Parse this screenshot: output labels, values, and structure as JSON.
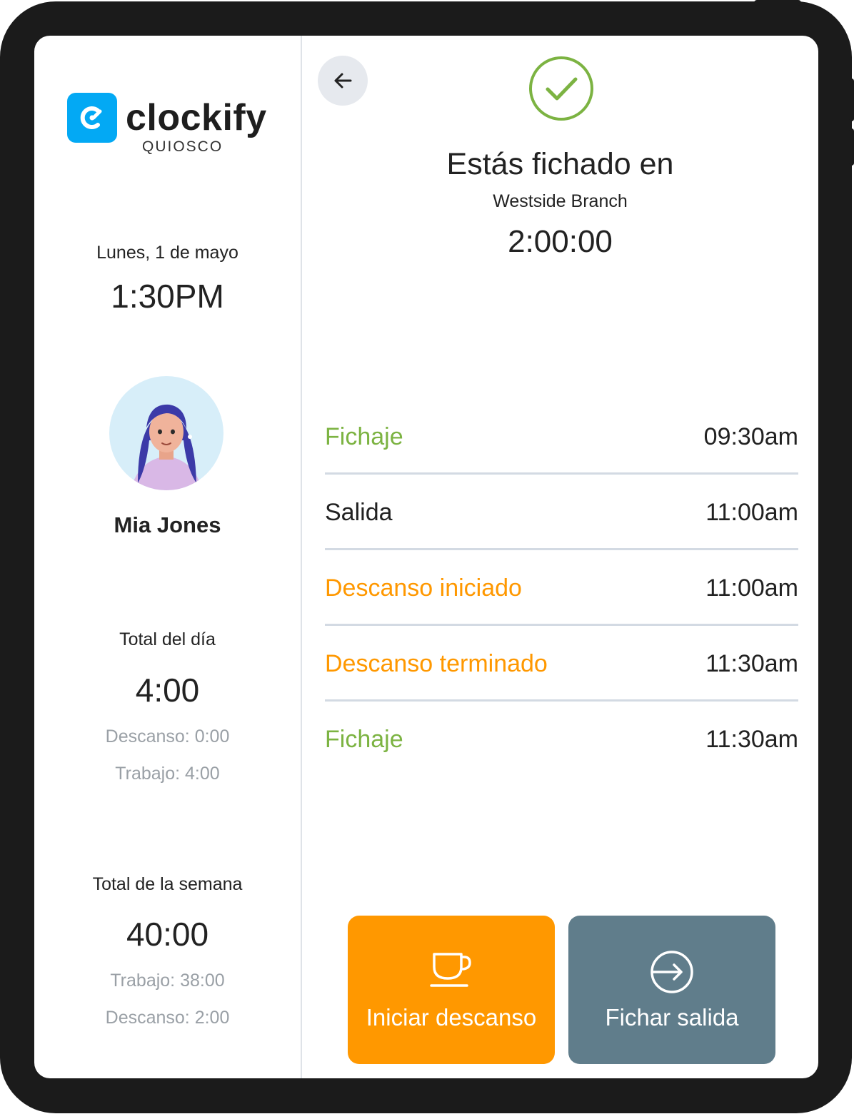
{
  "brand": {
    "name": "clockify",
    "subtitle": "QUIOSCO"
  },
  "left": {
    "date": "Lunes, 1 de mayo",
    "time": "1:30PM",
    "user_name": "Mia Jones",
    "day": {
      "label": "Total del día",
      "total": "4:00",
      "line1": "Descanso: 0:00",
      "line2": "Trabajo: 4:00"
    },
    "week": {
      "label": "Total de la semana",
      "total": "40:00",
      "line1": "Trabajo: 38:00",
      "line2": "Descanso: 2:00"
    }
  },
  "status": {
    "title": "Estás fichado en",
    "location": "Westside Branch",
    "timer": "2:00:00"
  },
  "events": [
    {
      "label": "Fichaje",
      "time": "09:30am",
      "color": "#7cb342"
    },
    {
      "label": "Salida",
      "time": "11:00am",
      "color": "#222222"
    },
    {
      "label": "Descanso iniciado",
      "time": "11:00am",
      "color": "#ff9800"
    },
    {
      "label": "Descanso terminado",
      "time": "11:30am",
      "color": "#ff9800"
    },
    {
      "label": "Fichaje",
      "time": "11:30am",
      "color": "#7cb342"
    }
  ],
  "actions": {
    "break_label": "Iniciar descanso",
    "clockout_label": "Fichar salida"
  },
  "icons": {
    "back": "arrow-left-icon",
    "status": "check-circle-icon",
    "break": "coffee-cup-icon",
    "clockout": "exit-arrow-icon"
  },
  "colors": {
    "brand": "#03a9f4",
    "clock_in": "#7cb342",
    "break": "#ff9800",
    "clock_out_button": "#607d8b"
  }
}
